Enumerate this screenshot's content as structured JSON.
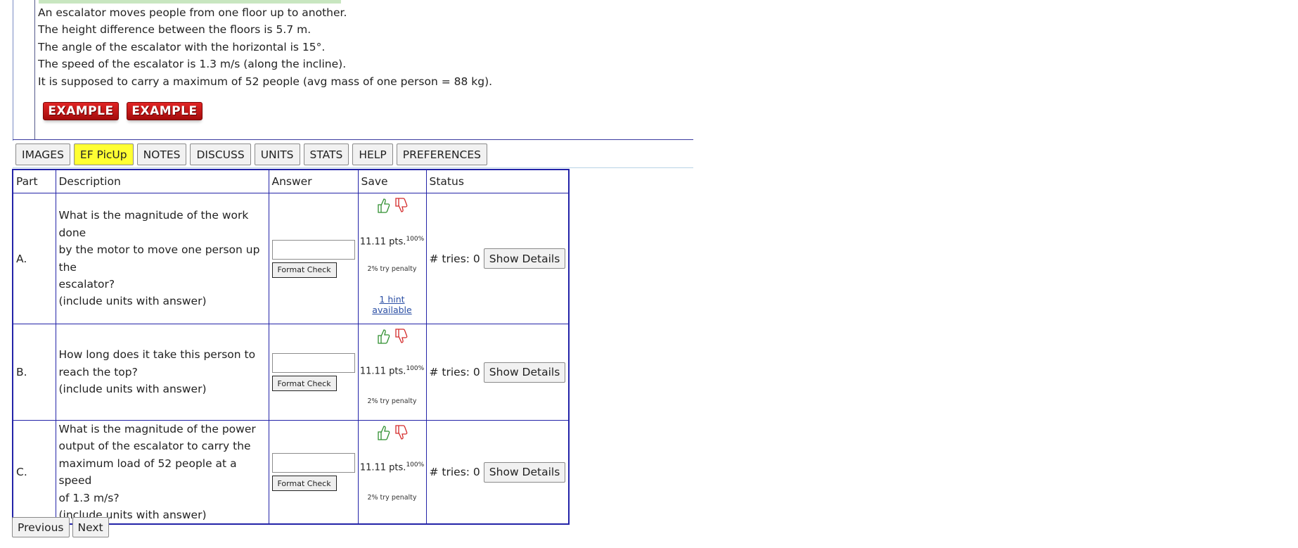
{
  "problem": {
    "lines": [
      "An escalator moves people from one floor up to another.",
      "The height difference between the floors is 5.7 m.",
      "The angle of the escalator with the horizontal is 15°.",
      "The speed of the escalator is 1.3 m/s (along the incline).",
      "It is supposed to carry a maximum of 52 people (avg mass of one person = 88 kg)."
    ]
  },
  "examples": [
    "EXAMPLE",
    "EXAMPLE"
  ],
  "tabs": [
    "IMAGES",
    "EF PicUp",
    "NOTES",
    "DISCUSS",
    "UNITS",
    "STATS",
    "HELP",
    "PREFERENCES"
  ],
  "active_tab": "EF PicUp",
  "table": {
    "headers": [
      "Part",
      "Description",
      "Answer",
      "Save",
      "Status"
    ],
    "rows": [
      {
        "part": "A.",
        "desc": [
          "What is the magnitude of the work done",
          "by the motor to move one person up the",
          "escalator?",
          "(include units with answer)"
        ],
        "pts": "11.11 pts.",
        "pct": "100%",
        "penalty": "2% try penalty",
        "hint": "1 hint available",
        "tries": "# tries: 0"
      },
      {
        "part": "B.",
        "desc": [
          "How long does it take this person to",
          "reach the top?",
          "(include units with answer)"
        ],
        "pts": "11.11 pts.",
        "pct": "100%",
        "penalty": "2% try penalty",
        "hint": "",
        "tries": "# tries: 0"
      },
      {
        "part": "C.",
        "desc": [
          "What is the magnitude of the power",
          "output of the escalator to carry the",
          "maximum load of 52 people at a speed",
          "of 1.3 m/s?",
          "(include units with answer)"
        ],
        "pts": "11.11 pts.",
        "pct": "100%",
        "penalty": "2% try penalty",
        "hint": "",
        "tries": "# tries: 0"
      }
    ],
    "format_check": "Format Check",
    "show_details": "Show Details"
  },
  "nav": {
    "previous": "Previous",
    "next": "Next"
  },
  "colors": {
    "border": "#2323a8",
    "active_tab": "#ffff33",
    "example_red": "#c41717",
    "thumb_up": "#2f8f2f",
    "thumb_down": "#d42a2a"
  }
}
